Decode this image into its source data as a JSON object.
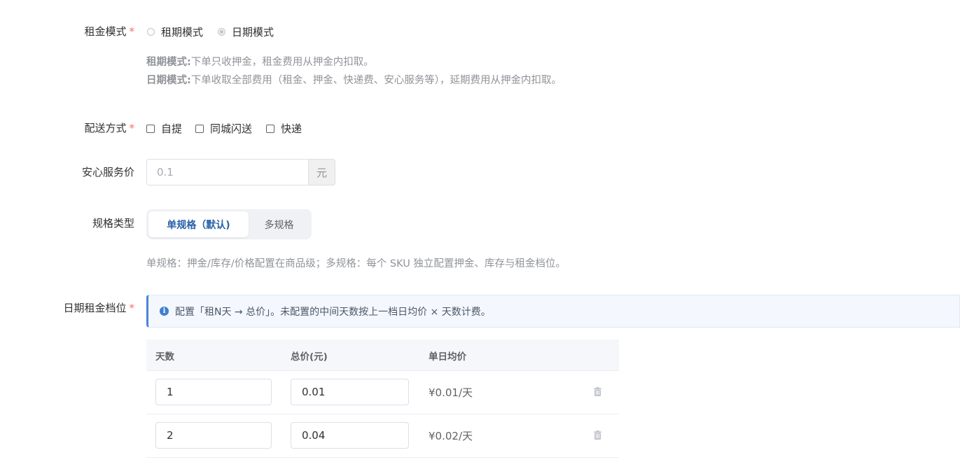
{
  "rent_mode": {
    "label": "租金模式",
    "required_mark": "*",
    "options": [
      {
        "label": "租期模式",
        "checked": false
      },
      {
        "label": "日期模式",
        "checked": true
      }
    ],
    "hint_term_title": "租期模式:",
    "hint_term_text": "下单只收押金，租金费用从押金内扣取。",
    "hint_date_title": "日期模式:",
    "hint_date_text": "下单收取全部费用（租金、押金、快递费、安心服务等），延期费用从押金内扣取。"
  },
  "delivery": {
    "label": "配送方式",
    "required_mark": "*",
    "options": [
      {
        "label": "自提",
        "checked": false
      },
      {
        "label": "同城闪送",
        "checked": false
      },
      {
        "label": "快递",
        "checked": false
      }
    ]
  },
  "service_price": {
    "label": "安心服务价",
    "placeholder": "0.1",
    "unit": "元"
  },
  "spec_type": {
    "label": "规格类型",
    "options": [
      "单规格（默认)",
      "多规格"
    ],
    "active_index": 0,
    "hint": "单规格：押金/库存/价格配置在商品级；多规格：每个 SKU 独立配置押金、库存与租金档位。"
  },
  "date_tiers": {
    "label": "日期租金档位",
    "required_mark": "*",
    "alert_icon": "info-icon",
    "alert_text": "配置「租N天 → 总价」。未配置的中间天数按上一档日均价 × 天数计费。",
    "columns": [
      "天数",
      "总价(元)",
      "单日均价"
    ],
    "rows": [
      {
        "days": "1",
        "total": "0.01",
        "avg": "¥0.01/天"
      },
      {
        "days": "2",
        "total": "0.04",
        "avg": "¥0.02/天"
      }
    ]
  },
  "colors": {
    "primary": "#2962a8",
    "required": "#f56c6c",
    "hint": "#909399",
    "alert_border": "#4a86d4"
  }
}
